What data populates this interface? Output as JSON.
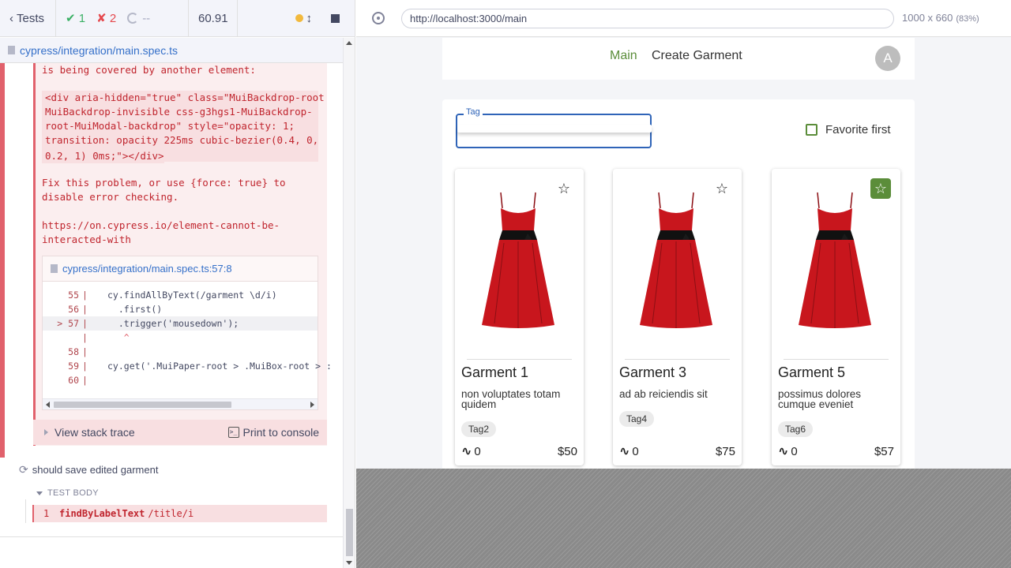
{
  "reporter": {
    "header": {
      "tests_label": "Tests",
      "passed": "1",
      "failed": "2",
      "pending": "--",
      "duration": "60.91"
    },
    "spec_path": "cypress/integration/main.spec.ts",
    "error": {
      "lines": [
        "is being covered by another element:",
        "",
        "",
        "",
        "",
        "",
        "",
        "",
        "Fix this problem, or use {force: true} to",
        "disable error checking.",
        "",
        "https://on.cypress.io/element-cannot-be-",
        "interacted-with"
      ],
      "code_lines": [
        "<div aria-hidden=\"true\" class=\"MuiBackdrop-root",
        "MuiBackdrop-invisible css-g3hgs1-MuiBackdrop-",
        "root-MuiModal-backdrop\" style=\"opacity: 1;",
        "transition: opacity 225ms cubic-bezier(0.4, 0,",
        "0.2, 1) 0ms;\"></div>"
      ],
      "stack_file": "cypress/integration/main.spec.ts:57:8",
      "code_frame": [
        {
          "num": "55",
          "prefix": "",
          "text": "cy.findAllByText(/garment \\d/i)"
        },
        {
          "num": "56",
          "prefix": "",
          "text": "  .first()"
        },
        {
          "num": "57",
          "prefix": "> ",
          "text": "  .trigger('mousedown');"
        },
        {
          "num": "",
          "prefix": "",
          "text": "   ^"
        },
        {
          "num": "58",
          "prefix": "",
          "text": ""
        },
        {
          "num": "59",
          "prefix": "",
          "text": "cy.get('.MuiPaper-root > .MuiBox-root > :"
        },
        {
          "num": "60",
          "prefix": "",
          "text": ""
        }
      ],
      "view_stack_trace": "View stack trace",
      "print_to_console": "Print to console"
    },
    "test2": {
      "title": "should save edited garment",
      "body_label": "TEST BODY",
      "command_num": "1",
      "command_name": "findByLabelText",
      "command_msg": "/title/i"
    }
  },
  "runner": {
    "url": "http://localhost:3000/main",
    "viewport": "1000 x 660",
    "scale": "(83%)"
  },
  "app": {
    "nav": {
      "main": "Main",
      "create": "Create Garment",
      "avatar_initial": "A"
    },
    "filter": {
      "tag_label": "Tag",
      "favorite_first": "Favorite first"
    },
    "colors": {
      "accent": "#5b8d3a",
      "focus": "#2f64b8",
      "dress": "#c8161d"
    },
    "garments": [
      {
        "title": "Garment 1",
        "description": "non voluptates totam quidem",
        "tag": "Tag2",
        "likes": "0",
        "price": "$50",
        "favorite": false
      },
      {
        "title": "Garment 3",
        "description": "ad ab reiciendis sit",
        "tag": "Tag4",
        "likes": "0",
        "price": "$75",
        "favorite": false
      },
      {
        "title": "Garment 5",
        "description": "possimus dolores cumque eveniet",
        "tag": "Tag6",
        "likes": "0",
        "price": "$57",
        "favorite": true
      }
    ]
  }
}
